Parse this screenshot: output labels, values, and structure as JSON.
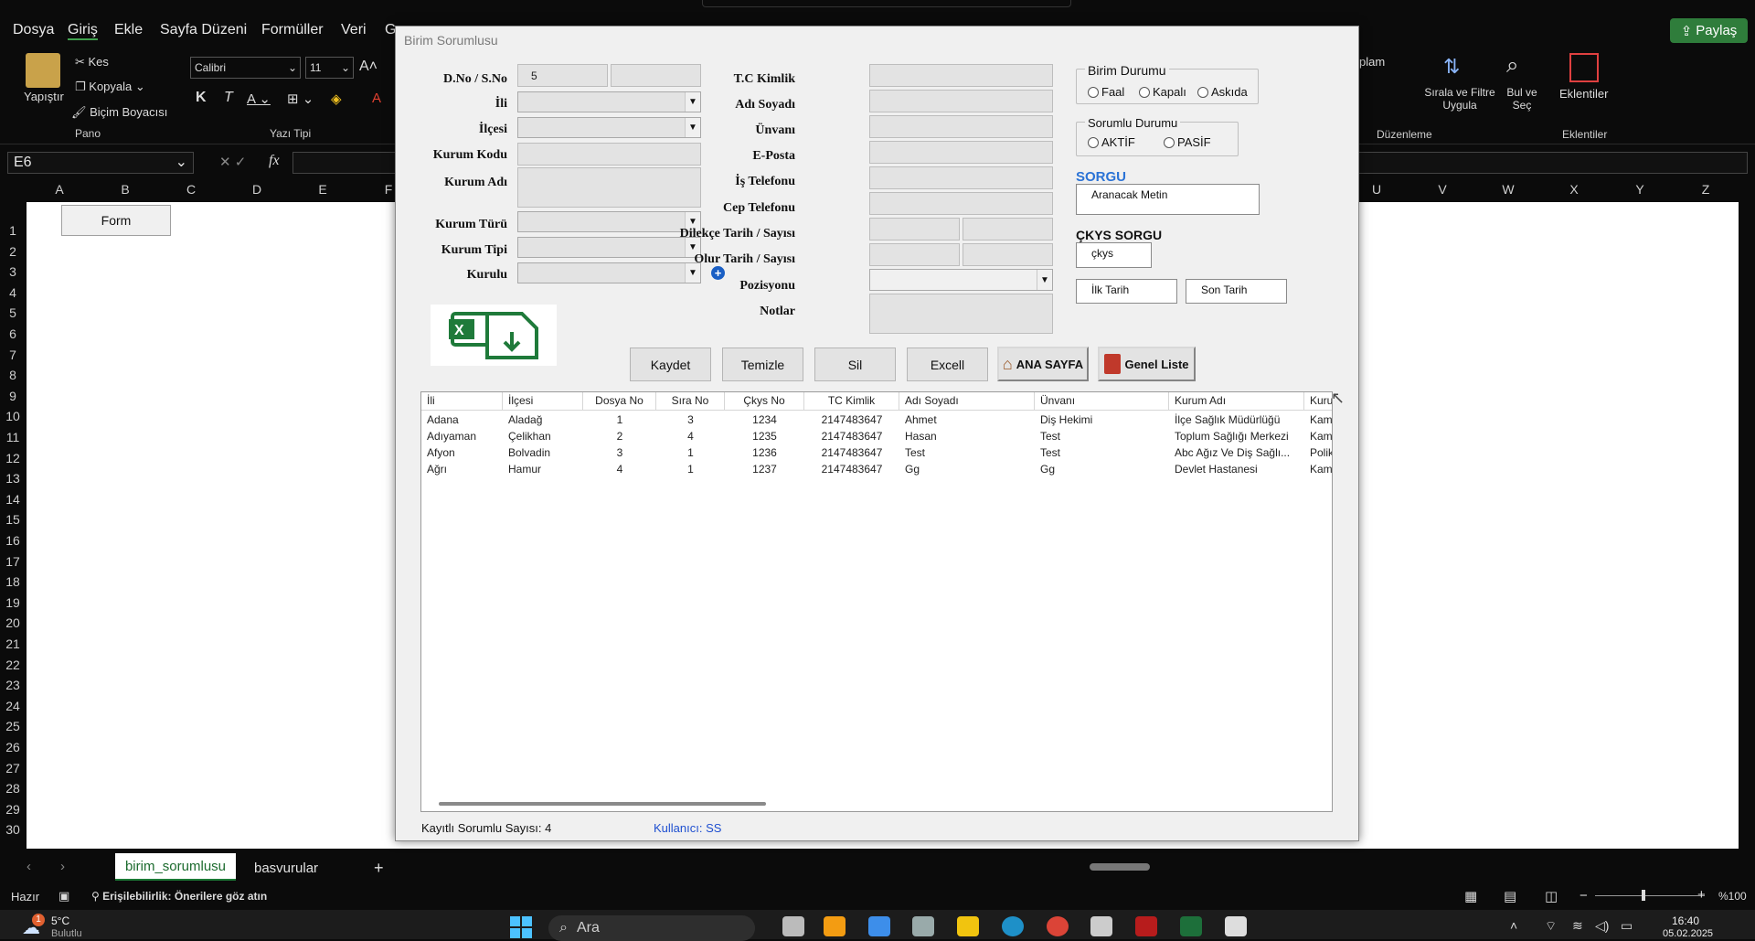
{
  "excel": {
    "menu": [
      "Dosya",
      "Giriş",
      "Ekle",
      "Sayfa Düzeni",
      "Formüller",
      "Veri",
      "G"
    ],
    "share_label": "Paylaş",
    "ribbon": {
      "paste": "Yapıştır",
      "cut": "Kes",
      "copy": "Kopyala",
      "format_painter": "Biçim Boyacısı",
      "group_clipboard": "Pano",
      "font_name": "Calibri",
      "font_size": "11",
      "bold": "K",
      "italic": "T",
      "group_font": "Yazı Tipi",
      "partial_label": "plam",
      "sort_filter": "Sırala ve Filtre Uygula",
      "find_select": "Bul ve Seç",
      "group_editing": "Düzenleme",
      "addins": "Eklentiler",
      "group_addins": "Eklentiler"
    },
    "name_box": "E6",
    "fx": "fx",
    "columns_left": [
      "A",
      "B",
      "C",
      "D",
      "E",
      "F"
    ],
    "columns_right": [
      "U",
      "V",
      "W",
      "X",
      "Y",
      "Z"
    ],
    "rows": [
      "1",
      "2",
      "3",
      "4",
      "5",
      "6",
      "7",
      "8",
      "9",
      "10",
      "11",
      "12",
      "13",
      "14",
      "15",
      "16",
      "17",
      "18",
      "19",
      "20",
      "21",
      "22",
      "23",
      "24",
      "25",
      "26",
      "27",
      "28",
      "29",
      "30"
    ],
    "form_button": "Form",
    "sheet_tabs": {
      "active": "birim_sorumlusu",
      "other": "basvurular",
      "add": "+"
    },
    "status": {
      "ready": "Hazır",
      "accessibility": "Erişilebilirlik: Önerilere göz atın",
      "zoom": "%100"
    }
  },
  "dialog": {
    "title": "Birim Sorumlusu",
    "labels": {
      "dno": "D.No / S.No",
      "ili": "İli",
      "ilcesi": "İlçesi",
      "kurum_kodu": "Kurum Kodu",
      "kurum_adi": "Kurum Adı",
      "kurum_turu": "Kurum Türü",
      "kurum_tipi": "Kurum Tipi",
      "kurulu": "Kurulu",
      "tc": "T.C Kimlik",
      "adi_soyadi": "Adı Soyadı",
      "unvani": "Ünvanı",
      "eposta": "E-Posta",
      "is_tel": "İş Telefonu",
      "cep_tel": "Cep Telefonu",
      "dilekce": "Dilekçe Tarih / Sayısı",
      "olur": "Olur Tarih / Sayısı",
      "pozisyonu": "Pozisyonu",
      "notlar": "Notlar"
    },
    "dno_value": "5",
    "birim_durumu": {
      "title": "Birim Durumu",
      "options": [
        "Faal",
        "Kapalı",
        "Askıda"
      ]
    },
    "sorumlu_durumu": {
      "title": "Sorumlu Durumu",
      "options": [
        "AKTİF",
        "PASİF"
      ]
    },
    "sorgu": {
      "title": "SORGU",
      "placeholder": "Aranacak Metin"
    },
    "ckys_sorgu": {
      "title": "ÇKYS SORGU",
      "value": "çkys"
    },
    "ilk_tarih": "İlk Tarih",
    "son_tarih": "Son Tarih",
    "buttons": {
      "kaydet": "Kaydet",
      "temizle": "Temizle",
      "sil": "Sil",
      "excell": "Excell",
      "ana_sayfa": "ANA SAYFA",
      "genel_liste": "Genel Liste"
    },
    "list": {
      "headers": [
        "İli",
        "İlçesi",
        "Dosya No",
        "Sıra No",
        "Çkys No",
        "TC Kimlik",
        "Adı Soyadı",
        "Ünvanı",
        "Kurum Adı",
        "Kuru"
      ],
      "rows": [
        [
          "Adana",
          "Aladağ",
          "1",
          "3",
          "1234",
          "2147483647",
          "Ahmet",
          "Diş Hekimi",
          "İlçe Sağlık Müdürlüğü",
          "Kam"
        ],
        [
          "Adıyaman",
          "Çelikhan",
          "2",
          "4",
          "1235",
          "2147483647",
          "Hasan",
          "Test",
          "Toplum Sağlığı Merkezi",
          "Kam"
        ],
        [
          "Afyon",
          "Bolvadin",
          "3",
          "1",
          "1236",
          "2147483647",
          "Test",
          "Test",
          "Abc Ağız Ve Diş Sağlı...",
          "Polik"
        ],
        [
          "Ağrı",
          "Hamur",
          "4",
          "1",
          "1237",
          "2147483647",
          "Gg",
          "Gg",
          "Devlet Hastanesi",
          "Kam"
        ]
      ]
    },
    "status_count": "Kayıtlı Sorumlu Sayısı: 4",
    "status_user": "Kullanıcı: SS"
  },
  "taskbar": {
    "weather": "5°C",
    "weather_sub": "Bulutlu",
    "search": "Ara",
    "time": "16:40",
    "date": "05.02.2025",
    "badge": "1"
  }
}
